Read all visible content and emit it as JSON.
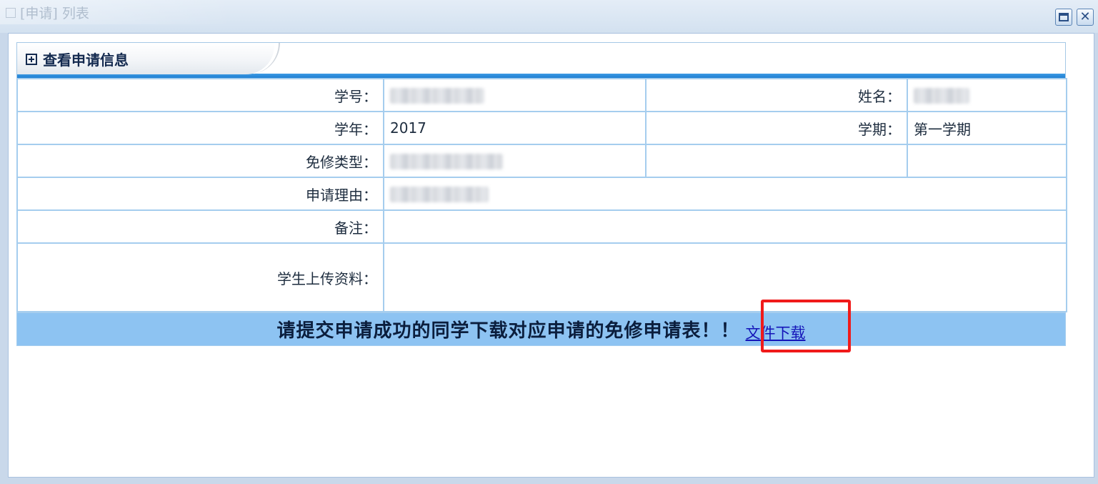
{
  "window": {
    "title": "[申请] 列表"
  },
  "panel": {
    "title": "查看申请信息"
  },
  "form": {
    "student_id_label": "学号：",
    "name_label": "姓名：",
    "year_label": "学年：",
    "year_value": "2017",
    "term_label": "学期：",
    "term_value": "第一学期",
    "exemption_type_label": "免修类型：",
    "reason_label": "申请理由：",
    "remark_label": "备注：",
    "upload_label": "学生上传资料："
  },
  "notice": {
    "text": "请提交申请成功的同学下载对应申请的免修申请表！！",
    "link_label": "文件下载"
  },
  "colors": {
    "notice_bg": "#8dc3f2",
    "link": "#1414b8",
    "highlight": "#f01a1a",
    "table_border": "#a5cdee"
  }
}
